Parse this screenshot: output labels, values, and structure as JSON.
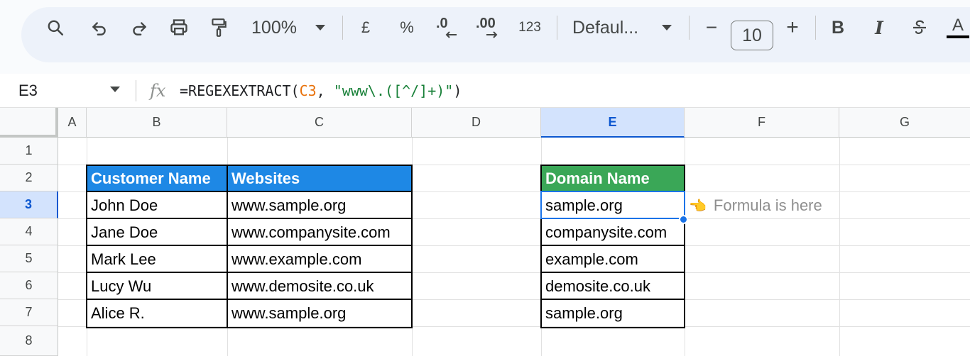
{
  "toolbar": {
    "zoom": "100%",
    "currency": "£",
    "percent": "%",
    "decrease_decimal": ".0",
    "increase_decimal": ".00",
    "number_format": "123",
    "font": "Defaul...",
    "font_size": "10",
    "minus": "−",
    "plus": "+",
    "bold": "B",
    "italic": "I",
    "text_color": "A",
    "icons": [
      "search-icon",
      "undo-icon",
      "redo-icon",
      "print-icon",
      "paint-format-icon",
      "chevron-down-icon",
      "decrease-decimal-icon",
      "increase-decimal-icon",
      "strikethrough-icon"
    ]
  },
  "formula_bar": {
    "cell_ref": "E3",
    "fx": "fx",
    "formula_prefix": "=REGEXEXTRACT(",
    "formula_ref": "C3",
    "formula_sep": ", ",
    "formula_string": "\"www\\.([^/]+)\"",
    "formula_suffix": ")"
  },
  "columns": [
    "A",
    "B",
    "C",
    "D",
    "E",
    "F",
    "G"
  ],
  "selected_column": "E",
  "rows": [
    "1",
    "2",
    "3",
    "4",
    "5",
    "6",
    "7",
    "8"
  ],
  "selected_row": "3",
  "table1": {
    "headers": [
      "Customer Name",
      "Websites"
    ],
    "rows": [
      [
        "John Doe",
        "www.sample.org"
      ],
      [
        "Jane Doe",
        "www.companysite.com"
      ],
      [
        "Mark Lee",
        "www.example.com"
      ],
      [
        "Lucy Wu",
        "www.demosite.co.uk"
      ],
      [
        "Alice R.",
        "www.sample.org"
      ]
    ]
  },
  "table2": {
    "header": "Domain Name",
    "rows": [
      "sample.org",
      "companysite.com",
      "example.com",
      "demosite.co.uk",
      "sample.org"
    ]
  },
  "annotation": {
    "hand": "👈",
    "text": "Formula is here"
  },
  "colors": {
    "header_blue": "#1e88e5",
    "header_green": "#3aa757",
    "selection": "#1a73e8",
    "formula_ref": "#e8710a",
    "formula_string": "#188038"
  }
}
